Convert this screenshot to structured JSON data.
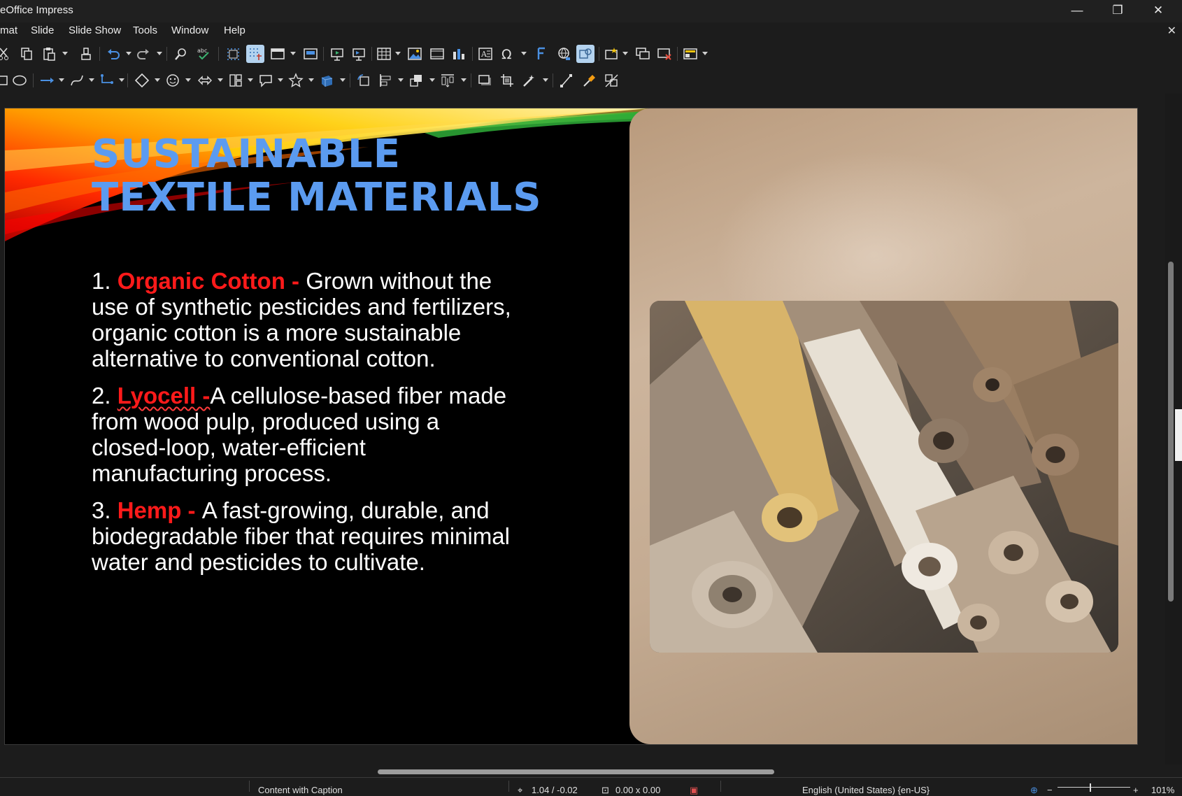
{
  "app": {
    "window_title": "eOffice Impress",
    "controls": {
      "minimize": "—",
      "maximize": "❐",
      "close": "✕"
    },
    "doc_close": "✕"
  },
  "menu": [
    {
      "label": "mat"
    },
    {
      "label": "Slide"
    },
    {
      "label": "Slide Show"
    },
    {
      "label": "Tools"
    },
    {
      "label": "Window"
    },
    {
      "label": "Help"
    }
  ],
  "toolbar_standard": [
    "cut-icon",
    "copy-icon",
    "paste-icon",
    "clone-formatting-icon",
    "undo-icon",
    "redo-icon",
    "find-replace-icon",
    "spelling-icon",
    "grid-icon",
    "snap-guides-icon",
    "display-views-icon",
    "master-slide-icon",
    "start-first-slide-icon",
    "start-current-slide-icon",
    "table-icon",
    "image-icon",
    "media-icon",
    "chart-icon",
    "textbox-icon",
    "special-character-icon",
    "fontwork-icon",
    "hyperlink-icon",
    "interaction-icon",
    "new-slide-icon",
    "duplicate-slide-icon",
    "delete-slide-icon",
    "slide-layout-icon"
  ],
  "toolbar_drawing": [
    "rectangle-icon",
    "ellipse-icon",
    "line-arrow-icon",
    "curve-icon",
    "connector-icon",
    "basic-shapes-icon",
    "symbol-shapes-icon",
    "block-arrows-icon",
    "flowchart-icon",
    "callouts-icon",
    "stars-icon",
    "3d-objects-icon",
    "rotate-icon",
    "align-icon",
    "arrange-icon",
    "distribute-icon",
    "shadow-icon",
    "crop-icon",
    "filter-icon",
    "points-icon",
    "glue-points-icon",
    "toggle-extrusion-icon"
  ],
  "slide": {
    "title_line1": "SUSTAINABLE",
    "title_line2": "TEXTILE MATERIALS",
    "bullets": [
      {
        "num": "1. ",
        "keyword": "Organic Cotton - ",
        "text": "Grown without the use of synthetic pesticides and fertilizers, organic cotton is a more sustainable alternative to conventional cotton."
      },
      {
        "num": "2. ",
        "keyword": "Lyocell -",
        "text": "A cellulose-based fiber made from wood pulp, produced using a closed-loop, water-efficient manufacturing process."
      },
      {
        "num": "3. ",
        "keyword": "Hemp - ",
        "text": "A fast-growing, durable, and biodegradable fiber that requires minimal water and pesticides to cultivate."
      }
    ],
    "colors": {
      "title": "#5b9bf0",
      "keyword": "#ff1a1a",
      "body_text": "#ffffff",
      "background": "#000000"
    },
    "image": "fabric-rolls-photo"
  },
  "status": {
    "layout": "Content with Caption",
    "position": "1.04 / -0.02",
    "size": "0.00 x 0.00",
    "language": "English (United States) {en-US}",
    "zoom": "101%"
  }
}
